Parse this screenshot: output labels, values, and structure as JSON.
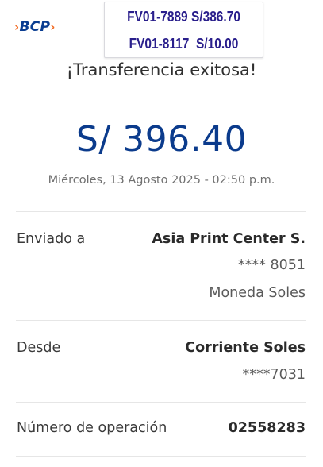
{
  "brand": {
    "logo_text": "BCP",
    "left_mark": "›",
    "right_mark": "›"
  },
  "note": {
    "line1": "FV01-7889 S/386.70",
    "line2": "FV01-8117  S/10.00"
  },
  "title": "¡Transferencia exitosa!",
  "amount": "S/ 396.40",
  "datetime": "Miércoles, 13 Agosto 2025 - 02:50 p.m.",
  "sent_to": {
    "label": "Enviado a",
    "name": "Asia Print Center S.",
    "account": "**** 8051",
    "currency": "Moneda Soles"
  },
  "from": {
    "label": "Desde",
    "account_type": "Corriente Soles",
    "account": "****7031"
  },
  "operation": {
    "label": "Número de operación",
    "number": "02558283"
  },
  "colors": {
    "brand_blue": "#0a3d91",
    "brand_orange": "#f26a21",
    "note_text": "#2a1f8c"
  }
}
